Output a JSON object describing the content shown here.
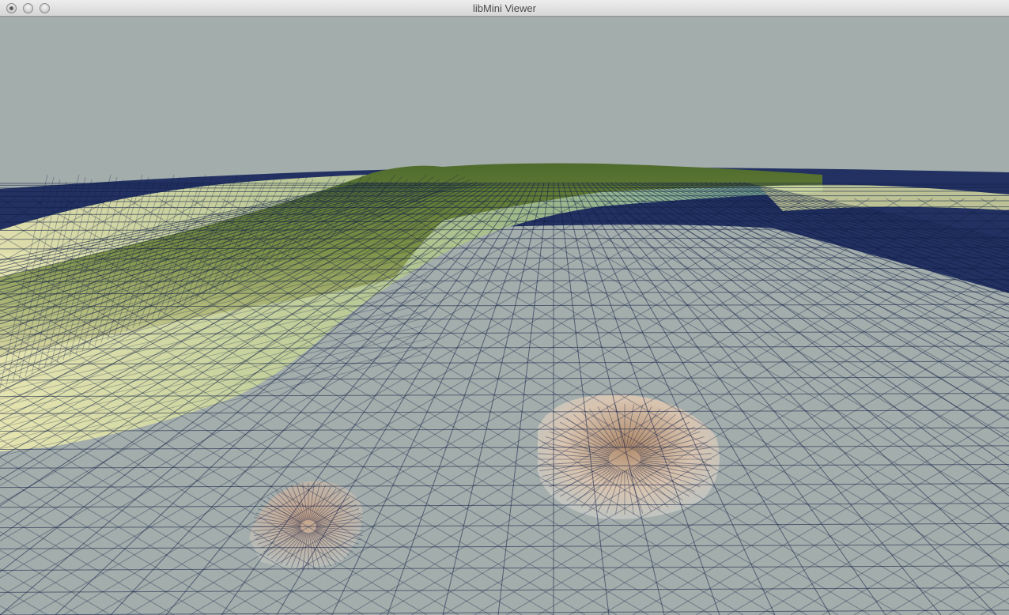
{
  "window": {
    "title": "libMini Viewer"
  },
  "colors": {
    "sky": "#a3adab",
    "ocean_deep": "#0e1b4d",
    "mesh_line": "#0f1d45",
    "land_green": "#556b2f",
    "land_yellow": "#e6e3a0",
    "island_sand": "#d9b9a0"
  },
  "icons": {
    "close": "close-dot-icon",
    "minimize": "minimize-dot-icon",
    "zoom": "zoom-dot-icon"
  }
}
